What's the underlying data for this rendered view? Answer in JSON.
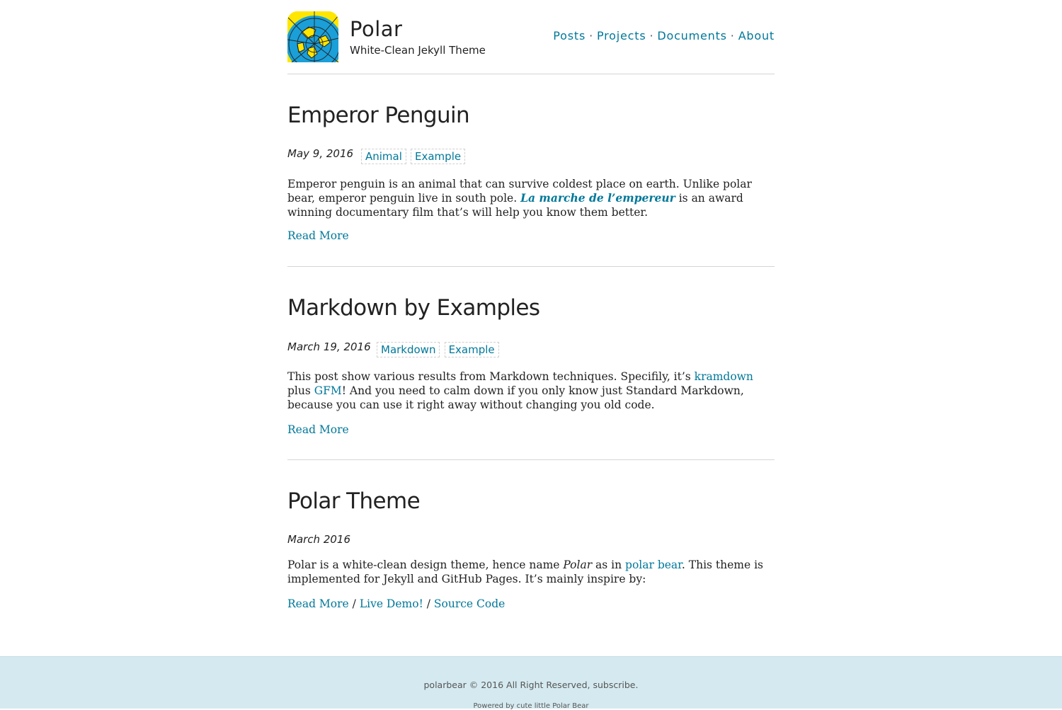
{
  "site": {
    "title": "Polar",
    "subtitle": "White-Clean Jekyll Theme",
    "nav": [
      "Posts",
      "Projects",
      "Documents",
      "About"
    ],
    "nav_separator": "·"
  },
  "posts": [
    {
      "title": "Emperor Penguin",
      "date": "May 9, 2016",
      "tags": [
        "Animal",
        "Example"
      ],
      "excerpt": {
        "t1": "Emperor penguin is an animal that can survive coldest place on earth. Unlike polar bear, emperor penguin live in south pole. ",
        "link": "La marche de l’empereur",
        "t2": " is an award winning documentary film that’s will help you know them better."
      },
      "read_more": "Read More"
    },
    {
      "title": "Markdown by Examples",
      "date": "March 19, 2016",
      "tags": [
        "Markdown",
        "Example"
      ],
      "excerpt": {
        "t1": "This post show various results from Markdown techniques. Specifily, it’s ",
        "link1": "kramdown",
        "t2": " plus ",
        "link2": "GFM",
        "t3": "! And you need to calm down if you only know just Standard Markdown, because you can use it right away without changing you old code."
      },
      "read_more": "Read More"
    },
    {
      "title": "Polar Theme",
      "date": "March 2016",
      "excerpt": {
        "t1": "Polar is a white-clean design theme, hence name ",
        "em": "Polar",
        "t2": " as in ",
        "link": "polar bear",
        "t3": ". This theme is implemented for Jekyll and GitHub Pages. It’s mainly inspire by:"
      },
      "links": [
        "Read More",
        "Live Demo!",
        "Source Code"
      ],
      "link_separator": "/"
    }
  ],
  "footer": {
    "line1_author": "polarbear",
    "line1_text": " © 2016 All Right Reserved, ",
    "line1_link": "subscribe",
    "line1_end": ".",
    "line2": "Powered by cute little Polar Bear"
  },
  "colors": {
    "link": "#00789a",
    "footer_bg": "#d5eaf0",
    "divider": "#d5d5d5"
  },
  "icons": {
    "logo": "globe-logo-icon"
  }
}
